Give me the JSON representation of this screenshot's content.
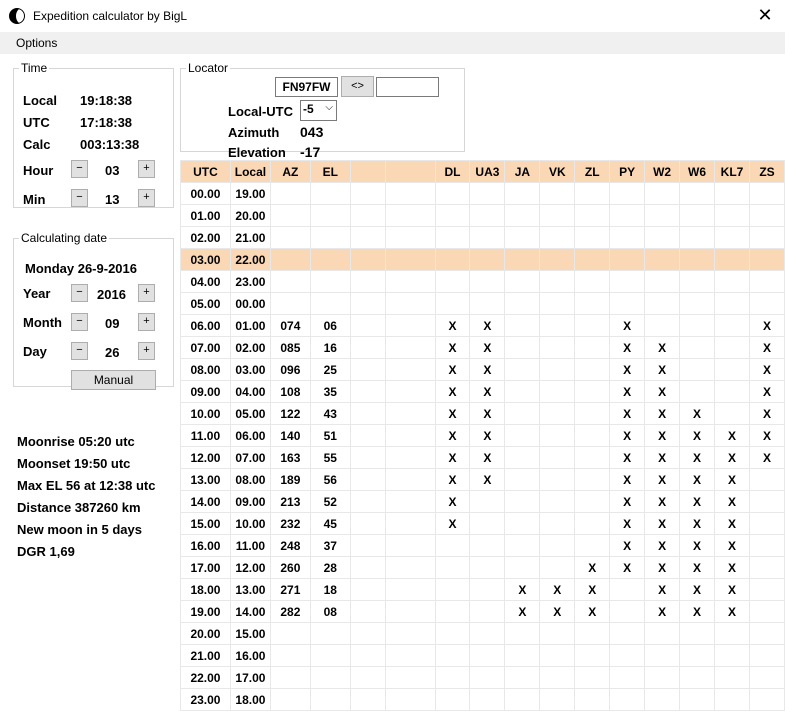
{
  "window": {
    "title": "Expedition calculator by BigL"
  },
  "menu": {
    "options": "Options"
  },
  "time": {
    "legend": "Time",
    "local_label": "Local",
    "local_value": "19:18:38",
    "utc_label": "UTC",
    "utc_value": "17:18:38",
    "calc_label": "Calc",
    "calc_value": "003:13:38",
    "hour_label": "Hour",
    "hour_value": "03",
    "min_label": "Min",
    "min_value": "13",
    "minus": "−",
    "plus": "+"
  },
  "date": {
    "legend": "Calculating date",
    "current": "Monday 26-9-2016",
    "year_label": "Year",
    "year_value": "2016",
    "month_label": "Month",
    "month_value": "09",
    "day_label": "Day",
    "day_value": "26",
    "manual_button": "Manual"
  },
  "locator": {
    "legend": "Locator",
    "value": "FN97FW",
    "swap_button": "<>",
    "target_value": "",
    "local_utc_label": "Local-UTC",
    "local_utc_value": "-5",
    "azimuth_label": "Azimuth",
    "azimuth_value": "043",
    "elevation_label": "Elevation",
    "elevation_value": "-17"
  },
  "moon_info": [
    "Moonrise 05:20 utc",
    "Moonset 19:50 utc",
    "Max EL 56 at 12:38 utc",
    "Distance 387260 km",
    "New moon in 5 days",
    "DGR 1,69"
  ],
  "table": {
    "headers": [
      "UTC",
      "Local",
      "AZ",
      "EL",
      "",
      "",
      "DL",
      "UA3",
      "JA",
      "VK",
      "ZL",
      "PY",
      "W2",
      "W6",
      "KL7",
      "ZS"
    ],
    "highlight_row": 3,
    "rows": [
      [
        "00.00",
        "19.00",
        "",
        "",
        "",
        "",
        "",
        "",
        "",
        "",
        "",
        "",
        "",
        "",
        "",
        ""
      ],
      [
        "01.00",
        "20.00",
        "",
        "",
        "",
        "",
        "",
        "",
        "",
        "",
        "",
        "",
        "",
        "",
        "",
        ""
      ],
      [
        "02.00",
        "21.00",
        "",
        "",
        "",
        "",
        "",
        "",
        "",
        "",
        "",
        "",
        "",
        "",
        "",
        ""
      ],
      [
        "03.00",
        "22.00",
        "",
        "",
        "",
        "",
        "",
        "",
        "",
        "",
        "",
        "",
        "",
        "",
        "",
        ""
      ],
      [
        "04.00",
        "23.00",
        "",
        "",
        "",
        "",
        "",
        "",
        "",
        "",
        "",
        "",
        "",
        "",
        "",
        ""
      ],
      [
        "05.00",
        "00.00",
        "",
        "",
        "",
        "",
        "",
        "",
        "",
        "",
        "",
        "",
        "",
        "",
        "",
        ""
      ],
      [
        "06.00",
        "01.00",
        "074",
        "06",
        "",
        "",
        "X",
        "X",
        "",
        "",
        "",
        "X",
        "",
        "",
        "",
        "X"
      ],
      [
        "07.00",
        "02.00",
        "085",
        "16",
        "",
        "",
        "X",
        "X",
        "",
        "",
        "",
        "X",
        "X",
        "",
        "",
        "X"
      ],
      [
        "08.00",
        "03.00",
        "096",
        "25",
        "",
        "",
        "X",
        "X",
        "",
        "",
        "",
        "X",
        "X",
        "",
        "",
        "X"
      ],
      [
        "09.00",
        "04.00",
        "108",
        "35",
        "",
        "",
        "X",
        "X",
        "",
        "",
        "",
        "X",
        "X",
        "",
        "",
        "X"
      ],
      [
        "10.00",
        "05.00",
        "122",
        "43",
        "",
        "",
        "X",
        "X",
        "",
        "",
        "",
        "X",
        "X",
        "X",
        "",
        "X"
      ],
      [
        "11.00",
        "06.00",
        "140",
        "51",
        "",
        "",
        "X",
        "X",
        "",
        "",
        "",
        "X",
        "X",
        "X",
        "X",
        "X"
      ],
      [
        "12.00",
        "07.00",
        "163",
        "55",
        "",
        "",
        "X",
        "X",
        "",
        "",
        "",
        "X",
        "X",
        "X",
        "X",
        "X"
      ],
      [
        "13.00",
        "08.00",
        "189",
        "56",
        "",
        "",
        "X",
        "X",
        "",
        "",
        "",
        "X",
        "X",
        "X",
        "X",
        ""
      ],
      [
        "14.00",
        "09.00",
        "213",
        "52",
        "",
        "",
        "X",
        "",
        "",
        "",
        "",
        "X",
        "X",
        "X",
        "X",
        ""
      ],
      [
        "15.00",
        "10.00",
        "232",
        "45",
        "",
        "",
        "X",
        "",
        "",
        "",
        "",
        "X",
        "X",
        "X",
        "X",
        ""
      ],
      [
        "16.00",
        "11.00",
        "248",
        "37",
        "",
        "",
        "",
        "",
        "",
        "",
        "",
        "X",
        "X",
        "X",
        "X",
        ""
      ],
      [
        "17.00",
        "12.00",
        "260",
        "28",
        "",
        "",
        "",
        "",
        "",
        "",
        "X",
        "X",
        "X",
        "X",
        "X",
        ""
      ],
      [
        "18.00",
        "13.00",
        "271",
        "18",
        "",
        "",
        "",
        "",
        "X",
        "X",
        "X",
        "",
        "X",
        "X",
        "X",
        ""
      ],
      [
        "19.00",
        "14.00",
        "282",
        "08",
        "",
        "",
        "",
        "",
        "X",
        "X",
        "X",
        "",
        "X",
        "X",
        "X",
        ""
      ],
      [
        "20.00",
        "15.00",
        "",
        "",
        "",
        "",
        "",
        "",
        "",
        "",
        "",
        "",
        "",
        "",
        "",
        ""
      ],
      [
        "21.00",
        "16.00",
        "",
        "",
        "",
        "",
        "",
        "",
        "",
        "",
        "",
        "",
        "",
        "",
        "",
        ""
      ],
      [
        "22.00",
        "17.00",
        "",
        "",
        "",
        "",
        "",
        "",
        "",
        "",
        "",
        "",
        "",
        "",
        "",
        ""
      ],
      [
        "23.00",
        "18.00",
        "",
        "",
        "",
        "",
        "",
        "",
        "",
        "",
        "",
        "",
        "",
        "",
        "",
        ""
      ]
    ]
  },
  "colors": {
    "highlight": "#fad7b5",
    "menubar": "#f0f0f0",
    "button": "#e1e1e1"
  }
}
